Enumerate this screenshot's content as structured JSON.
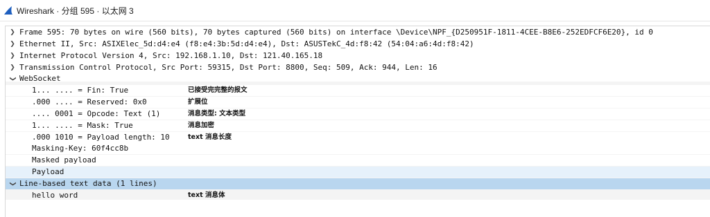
{
  "window": {
    "title": "Wireshark · 分组 595 · 以太网 3"
  },
  "tree": {
    "frame": "Frame 595: 70 bytes on wire (560 bits), 70 bytes captured (560 bits) on interface \\Device\\NPF_{D250951F-1811-4CEE-B8E6-252EDFCF6E20}, id 0",
    "ethernet": "Ethernet II, Src: ASIXElec_5d:d4:e4 (f8:e4:3b:5d:d4:e4), Dst: ASUSTekC_4d:f8:42 (54:04:a6:4d:f8:42)",
    "ip": "Internet Protocol Version 4, Src: 192.168.1.10, Dst: 121.40.165.18",
    "tcp": "Transmission Control Protocol, Src Port: 59315, Dst Port: 8800, Seq: 509, Ack: 944, Len: 16",
    "websocket": "WebSocket",
    "ws_fields": [
      {
        "text": "1... .... = Fin: True",
        "note": "已接受完完整的报文"
      },
      {
        "text": ".000 .... = Reserved: 0x0",
        "note": "扩展位"
      },
      {
        "text": ".... 0001 = Opcode: Text (1)",
        "note": "消息类型: 文本类型"
      },
      {
        "text": "1... .... = Mask: True",
        "note": "消息加密"
      },
      {
        "text": ".000 1010 = Payload length: 10",
        "note": "text 消息长度"
      },
      {
        "text": "Masking-Key: 60f4cc8b",
        "note": ""
      },
      {
        "text": "Masked payload",
        "note": ""
      },
      {
        "text": "Payload",
        "note": ""
      }
    ],
    "line_based": "Line-based text data (1 lines)",
    "hello": {
      "text": "hello word",
      "note": "text 消息体"
    }
  },
  "colors": {
    "selected": "#b9d6ef",
    "highlight": "#e6f1fb",
    "wireshark_fin": "#1e5fbf"
  }
}
